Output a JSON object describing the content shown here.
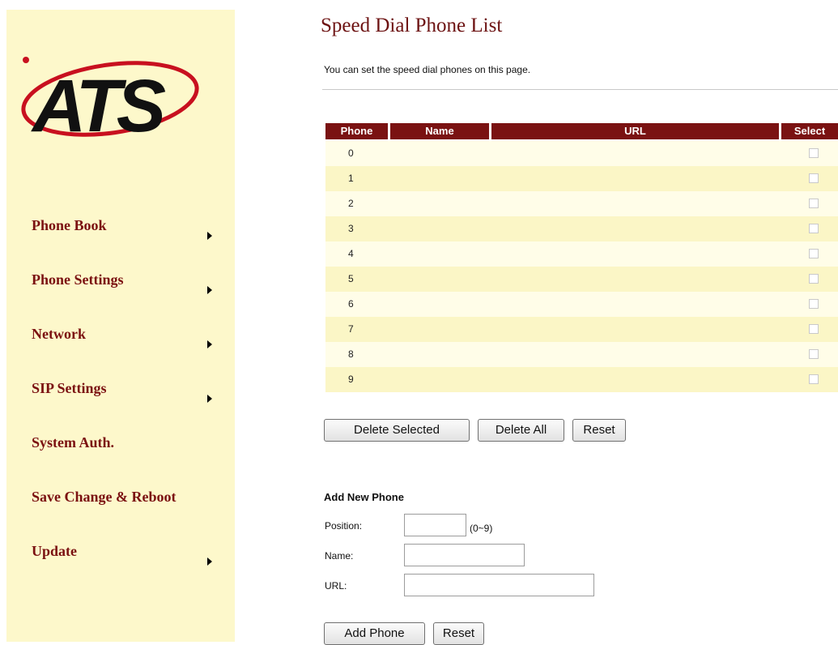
{
  "sidebar": {
    "logo_text": "ATS",
    "items": [
      {
        "label": "Phone Book",
        "has_arrow": true
      },
      {
        "label": "Phone Settings",
        "has_arrow": true
      },
      {
        "label": "Network",
        "has_arrow": true
      },
      {
        "label": "SIP Settings",
        "has_arrow": true
      },
      {
        "label": "System Auth.",
        "has_arrow": false
      },
      {
        "label": "Save Change & Reboot",
        "has_arrow": false
      },
      {
        "label": "Update",
        "has_arrow": true
      }
    ]
  },
  "main": {
    "title": "Speed Dial Phone List",
    "description": "You can set the speed dial phones on this page.",
    "table": {
      "columns": [
        "Phone",
        "Name",
        "URL",
        "Select"
      ],
      "rows": [
        {
          "phone": "0",
          "name": "",
          "url": "",
          "selected": false
        },
        {
          "phone": "1",
          "name": "",
          "url": "",
          "selected": false
        },
        {
          "phone": "2",
          "name": "",
          "url": "",
          "selected": false
        },
        {
          "phone": "3",
          "name": "",
          "url": "",
          "selected": false
        },
        {
          "phone": "4",
          "name": "",
          "url": "",
          "selected": false
        },
        {
          "phone": "5",
          "name": "",
          "url": "",
          "selected": false
        },
        {
          "phone": "6",
          "name": "",
          "url": "",
          "selected": false
        },
        {
          "phone": "7",
          "name": "",
          "url": "",
          "selected": false
        },
        {
          "phone": "8",
          "name": "",
          "url": "",
          "selected": false
        },
        {
          "phone": "9",
          "name": "",
          "url": "",
          "selected": false
        }
      ]
    },
    "buttons": {
      "delete_selected": "Delete Selected",
      "delete_all": "Delete All",
      "reset": "Reset"
    },
    "add_form": {
      "heading": "Add New Phone",
      "position_label": "Position:",
      "position_value": "",
      "position_range": "(0~9)",
      "name_label": "Name:",
      "name_value": "",
      "url_label": "URL:",
      "url_value": "",
      "add_button": "Add Phone",
      "reset_button": "Reset"
    }
  },
  "colors": {
    "sidebar_bg": "#fdf8cb",
    "accent": "#7a1212",
    "row_light": "#fffde8",
    "row_dark": "#fbf6c6"
  }
}
